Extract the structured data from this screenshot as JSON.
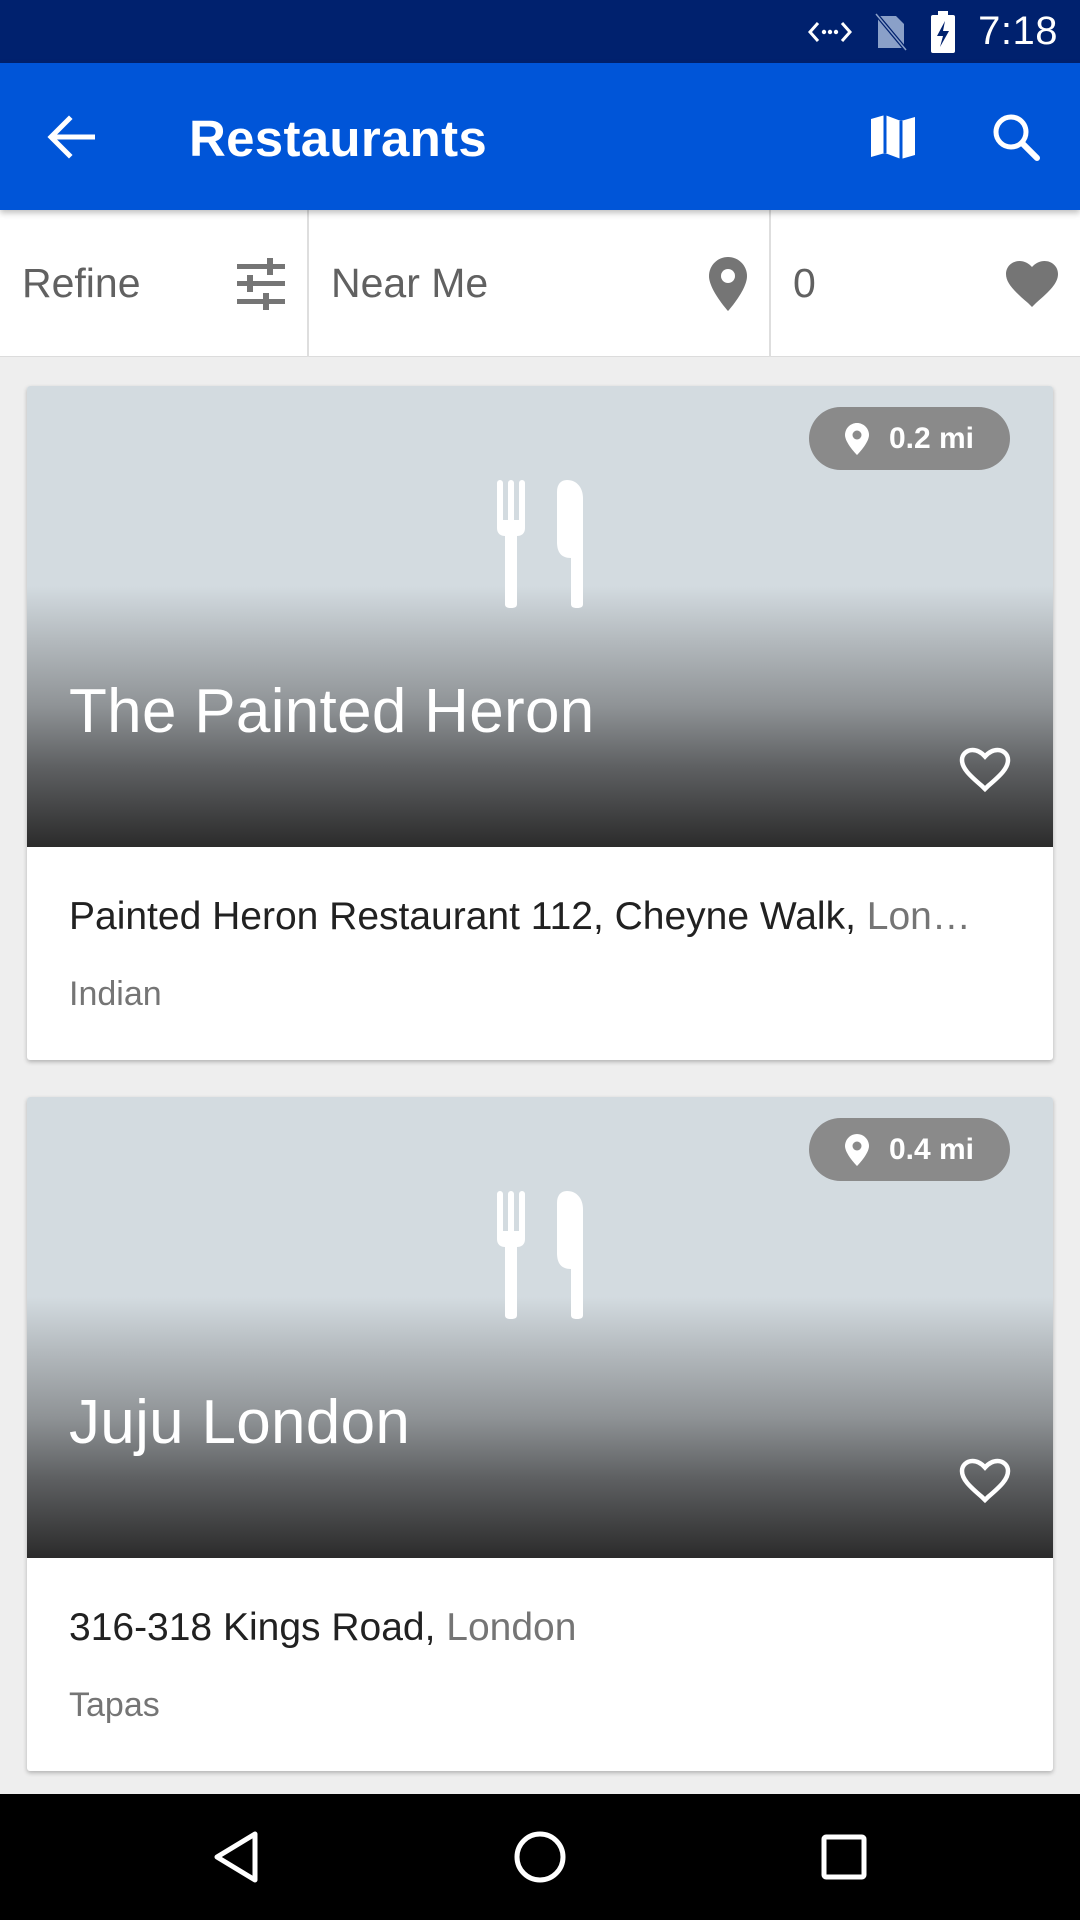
{
  "status_bar": {
    "time": "7:18",
    "icons": [
      "data-sync-icon",
      "no-sim-icon",
      "battery-charging-icon"
    ]
  },
  "app_bar": {
    "title": "Restaurants",
    "icons": [
      "back-arrow-icon",
      "map-icon",
      "search-icon"
    ]
  },
  "filter_bar": {
    "refine_label": "Refine",
    "location_label": "Near Me",
    "favorites_count": "0",
    "icons": [
      "sliders-icon",
      "location-pin-icon",
      "heart-icon"
    ]
  },
  "restaurants": [
    {
      "name": "The Painted Heron",
      "distance": "0.2 mi",
      "address_main": "Painted Heron Restaurant 112, Cheyne Walk, ",
      "address_city": "Lon…",
      "cuisine": "Indian"
    },
    {
      "name": "Juju London",
      "distance": "0.4 mi",
      "address_main": "316-318 Kings Road, ",
      "address_city": "London",
      "cuisine": "Tapas"
    }
  ],
  "colors": {
    "status_bar": "#00216e",
    "app_bar": "#0055d8",
    "background": "#eeeeee",
    "chip": "#8a8a8a"
  },
  "nav_bar": {
    "icons": [
      "back-triangle-icon",
      "home-circle-icon",
      "recents-square-icon"
    ]
  }
}
